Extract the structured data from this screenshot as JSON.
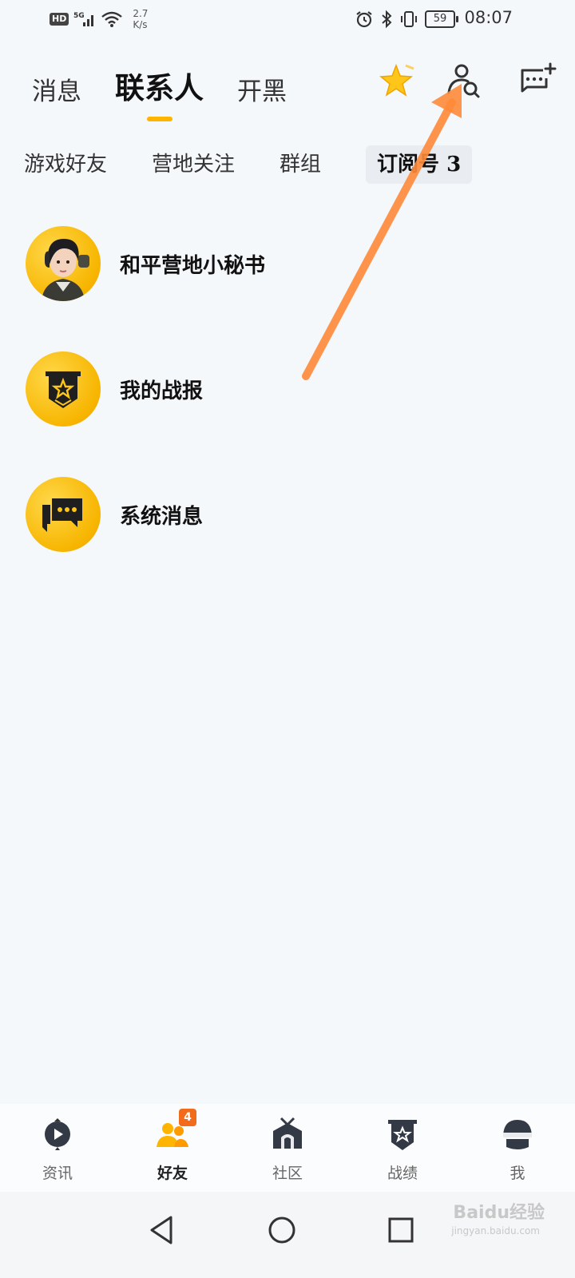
{
  "status_bar": {
    "hd": "HD",
    "network": "5G",
    "speed_value": "2.7",
    "speed_unit": "K/s",
    "battery": "59",
    "time": "08:07"
  },
  "top_tabs": [
    {
      "label": "消息",
      "active": false
    },
    {
      "label": "联系人",
      "active": true
    },
    {
      "label": "开黑",
      "active": false
    }
  ],
  "top_icons": [
    "star-icon",
    "contact-search-icon",
    "new-message-icon"
  ],
  "sub_tabs": [
    {
      "label": "游戏好友",
      "active": false
    },
    {
      "label": "营地关注",
      "active": false
    },
    {
      "label": "群组",
      "active": false
    },
    {
      "label": "订阅号 3",
      "active": true
    }
  ],
  "contacts": [
    {
      "name": "和平营地小秘书",
      "icon": "character-avatar"
    },
    {
      "name": "我的战报",
      "icon": "badge-star-icon"
    },
    {
      "name": "系统消息",
      "icon": "message-bubble-icon"
    }
  ],
  "bottom_nav": [
    {
      "label": "资讯",
      "icon": "news-play-icon",
      "active": false
    },
    {
      "label": "好友",
      "icon": "friends-icon",
      "active": true,
      "badge": "4"
    },
    {
      "label": "社区",
      "icon": "community-house-icon",
      "active": false
    },
    {
      "label": "战绩",
      "icon": "record-badge-icon",
      "active": false
    },
    {
      "label": "我",
      "icon": "helmet-icon",
      "active": false
    }
  ],
  "watermark": {
    "text": "Baidu经验",
    "sub": "jingyan.baidu.com"
  },
  "colors": {
    "accent": "#ffb400",
    "badge": "#f26a1b",
    "arrow": "#ff8a3a",
    "background": "#f5f8fb"
  }
}
